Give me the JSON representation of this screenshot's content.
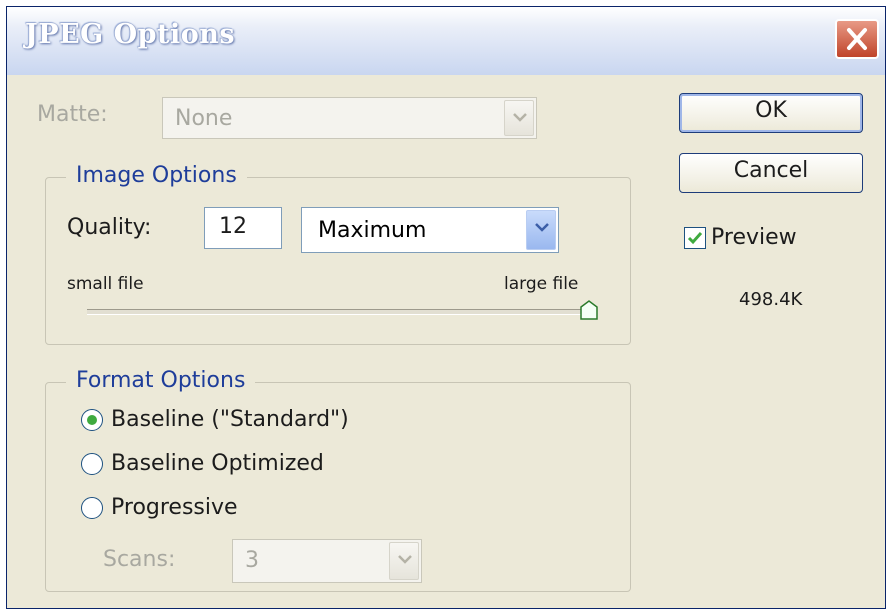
{
  "window": {
    "title": "JPEG Options"
  },
  "matte": {
    "label": "Matte:",
    "value": "None"
  },
  "image_options": {
    "title": "Image Options",
    "quality_label": "Quality:",
    "quality_value": "12",
    "quality_preset": "Maximum",
    "slider_min_label": "small file",
    "slider_max_label": "large file",
    "slider_level": 1.0
  },
  "format_options": {
    "title": "Format Options",
    "radios": [
      {
        "label": "Baseline (\"Standard\")",
        "checked": true
      },
      {
        "label": "Baseline Optimized",
        "checked": false
      },
      {
        "label": "Progressive",
        "checked": false
      }
    ],
    "scans_label": "Scans:",
    "scans_value": "3"
  },
  "buttons": {
    "ok": "OK",
    "cancel": "Cancel"
  },
  "preview": {
    "label": "Preview",
    "checked": true,
    "file_size": "498.4K"
  },
  "colors": {
    "accent_group_title": "#1e3d9a",
    "close_red": "#c0442a",
    "checkbox_green": "#3faa3f"
  },
  "icons": {
    "close": "close-icon",
    "dropdown": "chevron-down-icon",
    "check": "check-icon",
    "slider": "slider-thumb-icon"
  }
}
